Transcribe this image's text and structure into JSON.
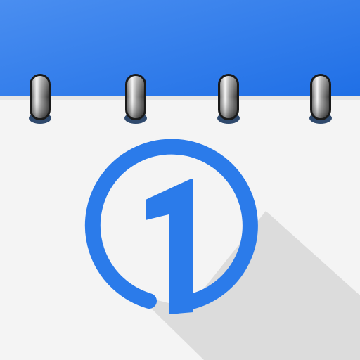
{
  "icon": {
    "name": "calendar-app-icon",
    "glyph": "one-icon",
    "colors": {
      "header_start": "#4a8ef0",
      "header_end": "#1f6fe6",
      "page": "#f4f4f4",
      "page_edge": "#e6e6e6",
      "accent": "#2b7bea",
      "shadow": "#d9d9d9"
    }
  }
}
